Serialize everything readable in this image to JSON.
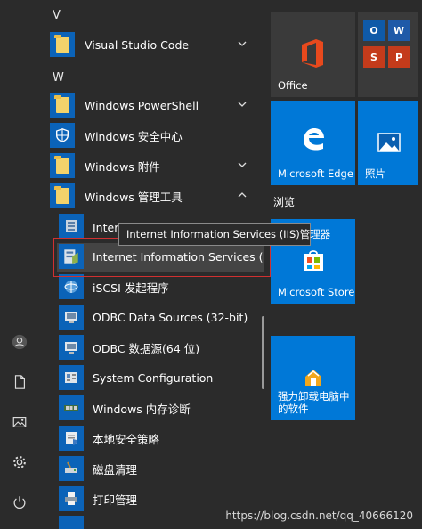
{
  "group_titles": {
    "top": "",
    "browse": "浏览"
  },
  "app_list": {
    "letter_v": "V",
    "letter_w": "W",
    "items": [
      {
        "label": "Visual Studio Code"
      },
      {
        "label": "Windows PowerShell"
      },
      {
        "label": "Windows 安全中心"
      },
      {
        "label": "Windows 附件"
      },
      {
        "label": "Windows 管理工具"
      }
    ],
    "sub_items": [
      {
        "label": "Internet Information Services (IIS) 6.0 管理器"
      },
      {
        "label": "Internet Information Services (II..."
      },
      {
        "label": "iSCSI 发起程序"
      },
      {
        "label": "ODBC Data Sources (32-bit)"
      },
      {
        "label": "ODBC 数据源(64 位)"
      },
      {
        "label": "System Configuration"
      },
      {
        "label": "Windows 内存诊断"
      },
      {
        "label": "本地安全策略"
      },
      {
        "label": "磁盘清理"
      },
      {
        "label": "打印管理"
      }
    ]
  },
  "tooltip": "Internet Information Services (IIS)管理器",
  "tiles": {
    "office": "Office",
    "edge": "Microsoft Edge",
    "photos": "照片",
    "store": "Microsoft Store",
    "uninstall_line1": "强力卸载电脑中",
    "uninstall_line2": "的软件"
  },
  "watermark": "https://blog.csdn.net/qq_40666120",
  "colors": {
    "tile_blue": "#0078d7",
    "tile_dark": "#3a3a3a",
    "folder_bg": "#0b63b8",
    "highlight_border": "#d03030"
  }
}
